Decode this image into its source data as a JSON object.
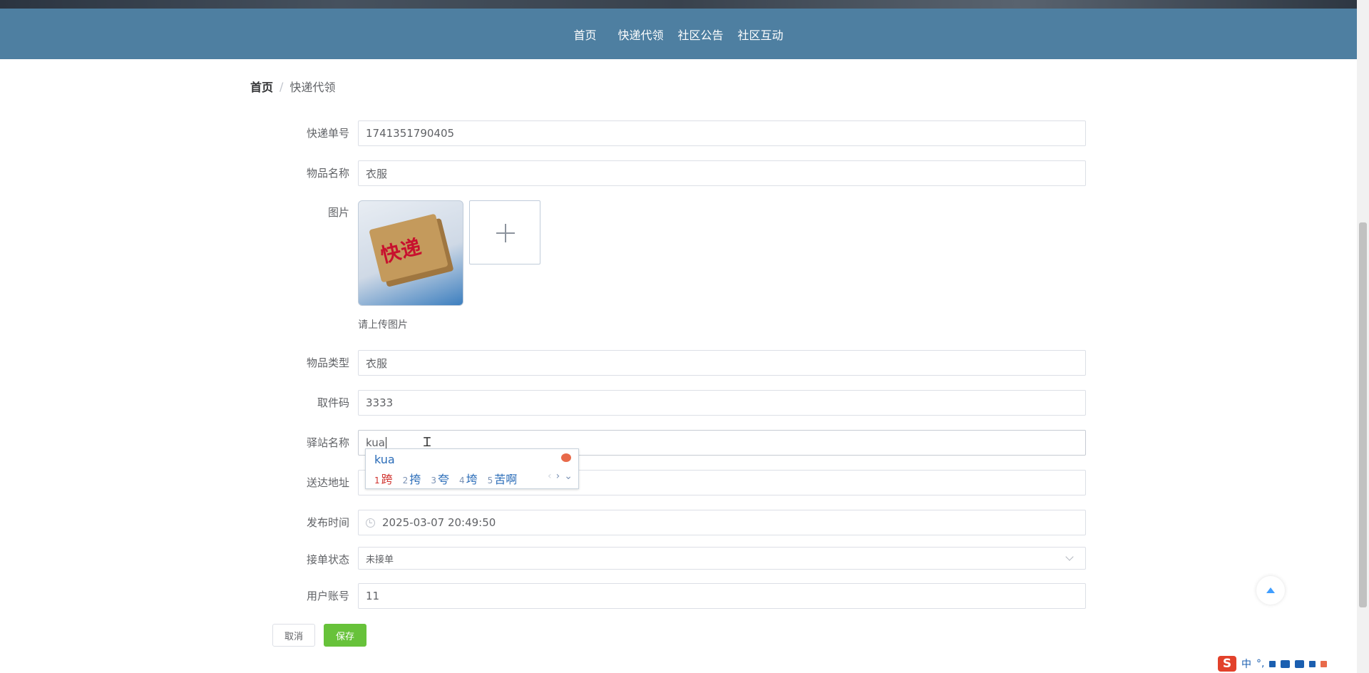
{
  "nav": {
    "items": [
      "首页",
      "快递代领",
      "社区公告",
      "社区互动"
    ]
  },
  "breadcrumb": {
    "home": "首页",
    "separator": "/",
    "current": "快递代领"
  },
  "form": {
    "tracking_no": {
      "label": "快递单号",
      "value": "1741351790405"
    },
    "item_name": {
      "label": "物品名称",
      "value": "衣服"
    },
    "image": {
      "label": "图片",
      "box_text": "快递",
      "tip": "请上传图片"
    },
    "item_type": {
      "label": "物品类型",
      "value": "衣服"
    },
    "pickup_code": {
      "label": "取件码",
      "value": "3333"
    },
    "station_name": {
      "label": "驿站名称",
      "value": "kua"
    },
    "address": {
      "label": "送达地址",
      "value": ""
    },
    "publish_time": {
      "label": "发布时间",
      "value": "2025-03-07 20:49:50"
    },
    "order_status": {
      "label": "接单状态",
      "value": "未接单"
    },
    "user_account": {
      "label": "用户账号",
      "value": "11"
    }
  },
  "ime_popup": {
    "composition": "kua",
    "candidates": [
      {
        "num": "1",
        "text": "跨"
      },
      {
        "num": "2",
        "text": "挎"
      },
      {
        "num": "3",
        "text": "夸"
      },
      {
        "num": "4",
        "text": "垮"
      },
      {
        "num": "5",
        "text": "苦啊"
      }
    ],
    "prev": "‹",
    "next": "›",
    "expand": "⌄"
  },
  "buttons": {
    "cancel": "取消",
    "save": "保存"
  },
  "ime_bar": {
    "logo": "S",
    "mode": "中",
    "punct": "°,"
  },
  "colors": {
    "nav_bg": "#4e7fa1",
    "save_green": "#67c23a",
    "accent_blue": "#409eff"
  }
}
